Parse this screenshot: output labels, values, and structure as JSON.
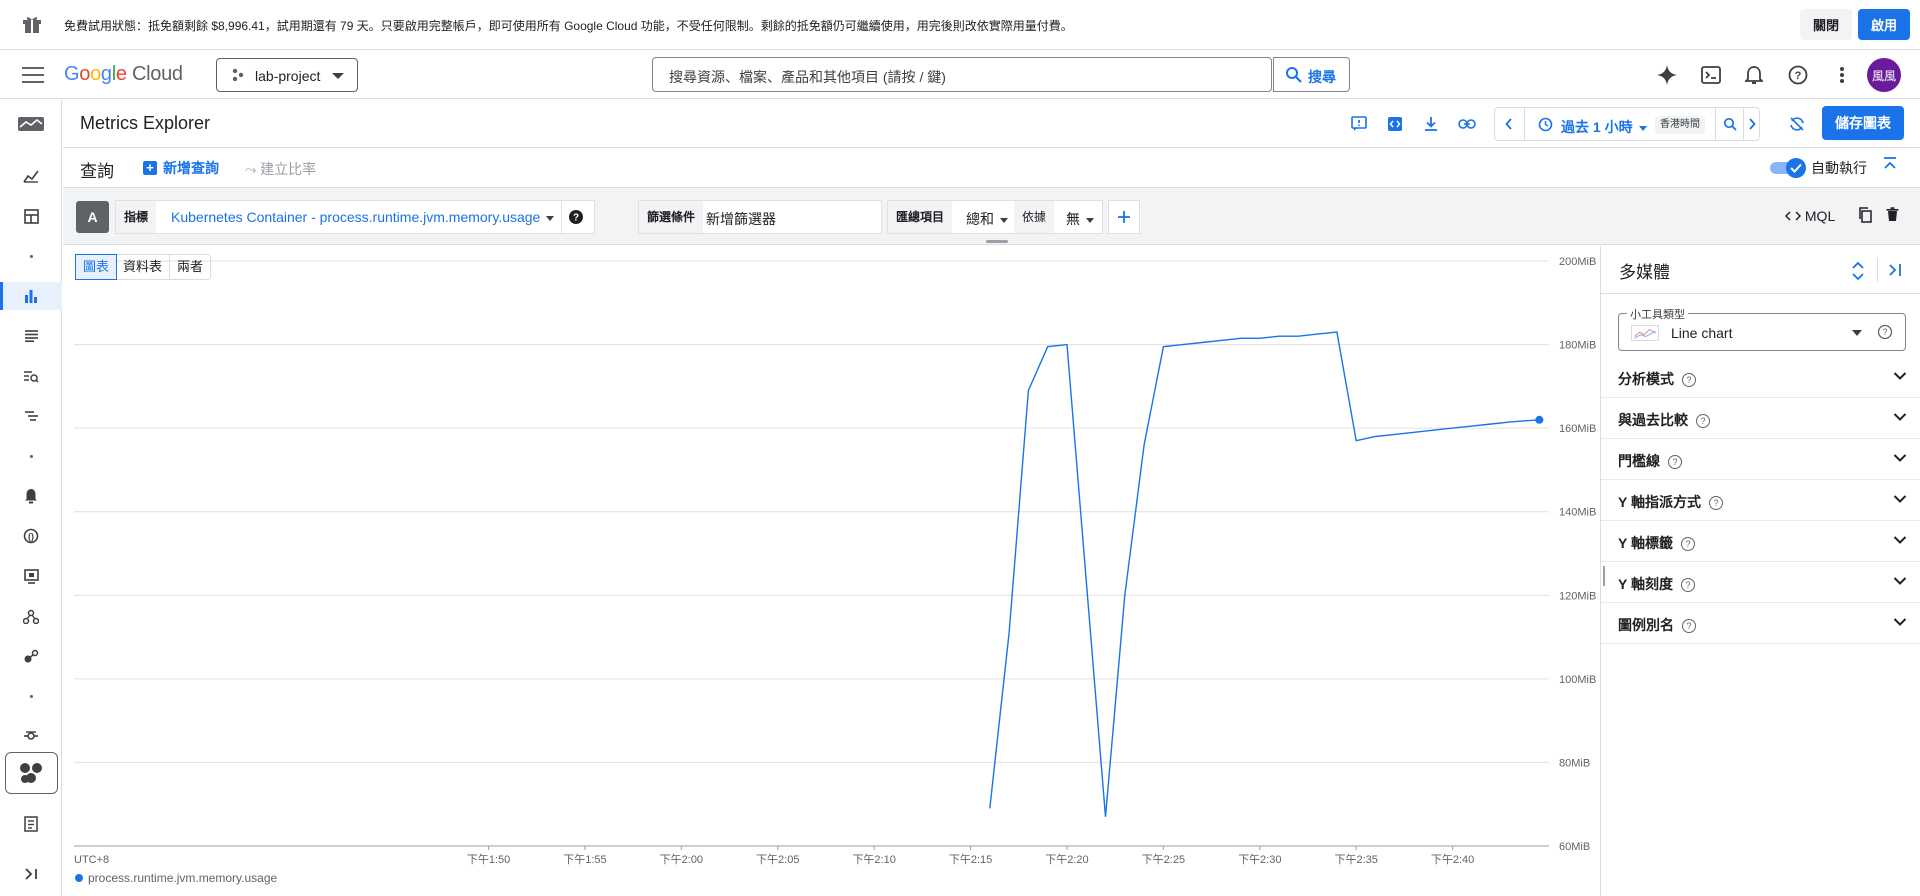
{
  "banner": {
    "message": "免費試用狀態：抵免額剩餘 $8,996.41，試用期還有 79 天。只要啟用完整帳戶，即可使用所有 Google Cloud 功能，不受任何限制。剩餘的抵免額仍可繼續使用，用完後則改依實際用量付費。",
    "close_label": "關閉",
    "activate_label": "啟用"
  },
  "topbar": {
    "logo_google": "Google",
    "logo_cloud": "Cloud",
    "project": "lab-project",
    "search_placeholder": "搜尋資源、檔案、產品和其他項目 (請按 / 鍵)",
    "search_button": "搜尋",
    "avatar_text": "風風",
    "icons": [
      "gemini-icon",
      "cloud-shell-icon",
      "notifications-icon",
      "help-icon",
      "more-vert-icon"
    ]
  },
  "page": {
    "title": "Metrics Explorer",
    "time_range": "過去 1 小時",
    "timezone": "香港時間",
    "save_button": "儲存圖表"
  },
  "query": {
    "title": "查詢",
    "add_query": "新增查詢",
    "create_ratio": "建立比率",
    "auto_run": "自動執行",
    "auto_run_on": true,
    "letter": "A",
    "metric_key": "指標",
    "metric_value": "Kubernetes Container - process.runtime.jvm.memory.usage",
    "filter_key": "篩選條件",
    "filter_value": "新增篩選器",
    "agg_key": "匯總項目",
    "agg_value": "總和",
    "by_key": "依據",
    "by_value": "無",
    "mql": "MQL"
  },
  "view_tabs": [
    "圖表",
    "資料表",
    "兩者"
  ],
  "chart_data": {
    "type": "line",
    "y_ticks": [
      "200MiB",
      "180MiB",
      "160MiB",
      "140MiB",
      "120MiB",
      "100MiB",
      "80MiB",
      "60MiB"
    ],
    "ylim": [
      60,
      200
    ],
    "y_unit": "MiB",
    "x_ticks": [
      "UTC+8",
      "下午1:50",
      "下午1:55",
      "下午2:00",
      "下午2:05",
      "下午2:10",
      "下午2:15",
      "下午2:20",
      "下午2:25",
      "下午2:30",
      "下午2:35",
      "下午2:40"
    ],
    "xlim_minutes": [
      -16.5,
      60
    ],
    "x_start": "下午1:45",
    "series": [
      {
        "name": "process.runtime.jvm.memory.usage",
        "color": "#1a73e8",
        "points": [
          [
            31.0,
            69
          ],
          [
            32.0,
            111
          ],
          [
            33.0,
            169
          ],
          [
            34.0,
            179.5
          ],
          [
            35.0,
            180
          ],
          [
            37.0,
            67
          ],
          [
            38.0,
            120
          ],
          [
            39.0,
            156
          ],
          [
            40.0,
            179.5
          ],
          [
            41.0,
            180
          ],
          [
            42.0,
            180.5
          ],
          [
            43.0,
            181
          ],
          [
            44.0,
            181.5
          ],
          [
            45.0,
            181.5
          ],
          [
            46.0,
            182
          ],
          [
            47.0,
            182
          ],
          [
            48.0,
            182.5
          ],
          [
            49.0,
            183
          ],
          [
            50.0,
            157
          ],
          [
            51.0,
            158
          ],
          [
            52.0,
            158.5
          ],
          [
            53.0,
            159
          ],
          [
            54.0,
            159.5
          ],
          [
            55.0,
            160
          ],
          [
            56.0,
            160.5
          ],
          [
            57.0,
            161
          ],
          [
            58.0,
            161.5
          ],
          [
            59.5,
            162
          ]
        ]
      }
    ],
    "grid": true,
    "legend_position": "bottom-left"
  },
  "panel": {
    "title": "多媒體",
    "widget_type_label": "小工具類型",
    "widget_type_value": "Line chart",
    "sections": [
      "分析模式",
      "與過去比較",
      "門檻線",
      "Y 軸指派方式",
      "Y 軸標籤",
      "Y 軸刻度",
      "圖例別名"
    ]
  }
}
